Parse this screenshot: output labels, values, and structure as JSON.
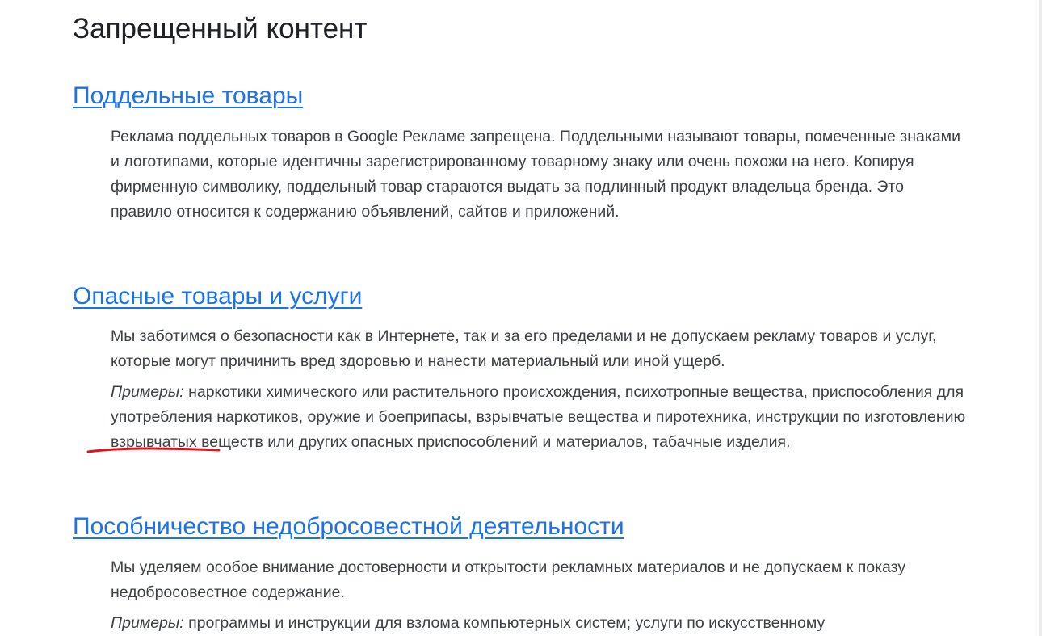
{
  "page_title": "Запрещенный контент",
  "sections": [
    {
      "heading": "Поддельные товары",
      "paragraphs": [
        {
          "text": "Реклама поддельных товаров в Google Рекламе запрещена. Поддельными называют товары, помеченные знаками и логотипами, которые идентичны зарегистрированному товарному знаку или очень похожи на него. Копируя фирменную символику, поддельный товар стараются выдать за подлинный продукт владельца бренда. Это правило относится к содержанию объявлений, сайтов и приложений."
        }
      ]
    },
    {
      "heading": "Опасные товары и услуги",
      "paragraphs": [
        {
          "text": "Мы заботимся о безопасности как в Интернете, так и за его пределами и не допускаем рекламу товаров и услуг, которые могут причинить вред здоровью и нанести материальный или иной ущерб."
        },
        {
          "label": "Примеры:",
          "text_before": " наркотики химического или растительного происхождения, психотропные вещества, приспособления для употребления наркотиков, оружие и боеприпасы, взрывчатые вещества и ",
          "highlight": "пиротехника",
          "text_after": ", инструкции по изготовлению взрывчатых веществ или других опасных приспособлений и материалов, табачные изделия."
        }
      ]
    },
    {
      "heading": "Пособничество недобросовестной деятельности",
      "paragraphs": [
        {
          "text": "Мы уделяем особое внимание достоверности и открытости рекламных материалов и не допускаем к показу недобросовестное содержание."
        },
        {
          "label": "Примеры:",
          "text": " программы и инструкции для взлома компьютерных систем; услуги по искусственному"
        }
      ]
    }
  ],
  "colors": {
    "link": "#1a73e8",
    "body_text": "#3c4043",
    "title": "#202124",
    "annotation": "#e0141c"
  }
}
